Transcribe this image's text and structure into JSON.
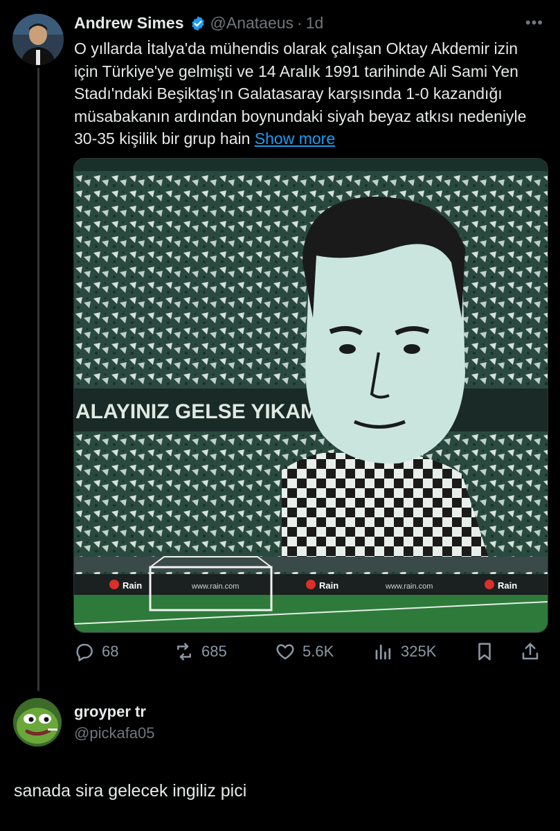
{
  "tweet": {
    "author_name": "Andrew Simes",
    "author_handle": "@Anataeus",
    "time": "1d",
    "separator": "·",
    "more_label": "•••",
    "text": "O yıllarda İtalya'da mühendis olarak çalışan Oktay Akdemir izin için Türkiye'ye gelmişti ve 14 Aralık 1991 tarihinde Ali Sami Yen Stadı'ndaki Beşiktaş'ın Galatasaray karşısında 1-0 kazandığı müsabakanın ardından boynundaki siyah beyaz atkısı nedeniyle 30-35 kişilik bir grup hain",
    "show_more": "Show more",
    "banner_text": "ALAYINIZ GELSE YIKAMAZ ŞAN",
    "ad_board_text": "Rain",
    "ad_board_url": "www.rain.com",
    "stats": {
      "replies": "68",
      "reposts": "685",
      "likes": "5.6K",
      "views": "325K"
    },
    "icons": [
      "reply-icon",
      "repost-icon",
      "like-icon",
      "views-icon",
      "bookmark-icon",
      "share-icon",
      "verified-icon"
    ],
    "accent_color": "#1d9bf0"
  },
  "reply": {
    "author_name": "groyper tr",
    "author_handle": "@pickafa05",
    "text": "sanada sira gelecek ingiliz pici"
  }
}
